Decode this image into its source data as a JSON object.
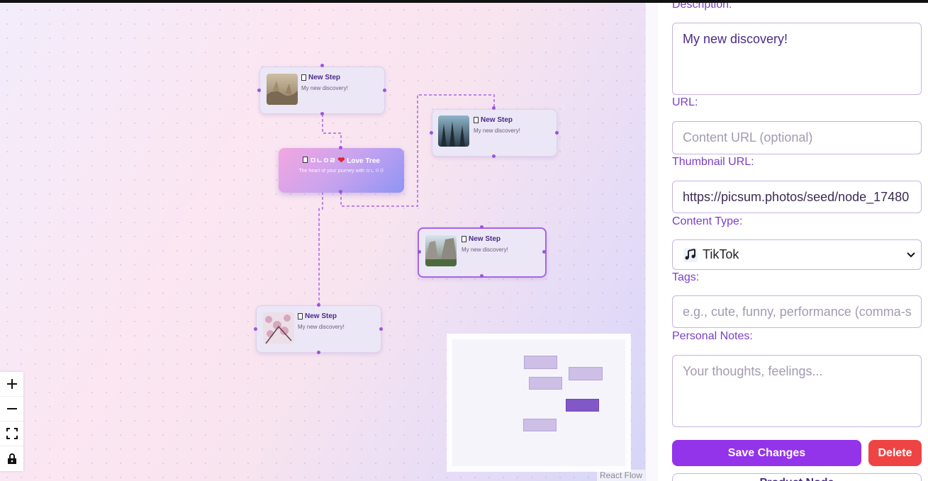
{
  "canvas": {
    "nodes": [
      {
        "id": "n1",
        "title": "New Step",
        "desc": "My new discovery!",
        "thumb": "autumn-field"
      },
      {
        "id": "n2",
        "title": "New Step",
        "desc": "My new discovery!",
        "thumb": "blue-forest"
      },
      {
        "id": "n3",
        "title": "New Step",
        "desc": "My new discovery!",
        "thumb": "yosemite-valley"
      },
      {
        "id": "n4",
        "title": "New Step",
        "desc": "My new discovery!",
        "thumb": "cherry-blossom"
      }
    ],
    "root": {
      "title_prefix": "ㅁㄴㅇㄹ",
      "title_suffix": "Love Tree",
      "desc": "The heart of your journey with ㅁㄴㅇㄹ"
    },
    "controls": [
      "zoom-in",
      "zoom-out",
      "fit-view",
      "toggle-interactivity"
    ],
    "attribution": "React Flow"
  },
  "panel": {
    "description_label": "Description:",
    "description_value": "My new discovery!",
    "url_label": "URL:",
    "url_placeholder": "Content URL (optional)",
    "thumb_label": "Thumbnail URL:",
    "thumb_value": "https://picsum.photos/seed/node_17480",
    "type_label": "Content Type:",
    "type_icon": "musical-notes-icon",
    "type_value": "TikTok",
    "tags_label": "Tags:",
    "tags_placeholder": "e.g., cute, funny, performance (comma-s",
    "notes_label": "Personal Notes:",
    "notes_placeholder": "Your thoughts, feelings...",
    "save_label": "Save Changes",
    "delete_label": "Delete",
    "next_label": "Product Node"
  },
  "colors": {
    "accent": "#9333ea",
    "danger": "#ef4444",
    "label": "#7b3fc9",
    "edge": "#9a55dd"
  }
}
